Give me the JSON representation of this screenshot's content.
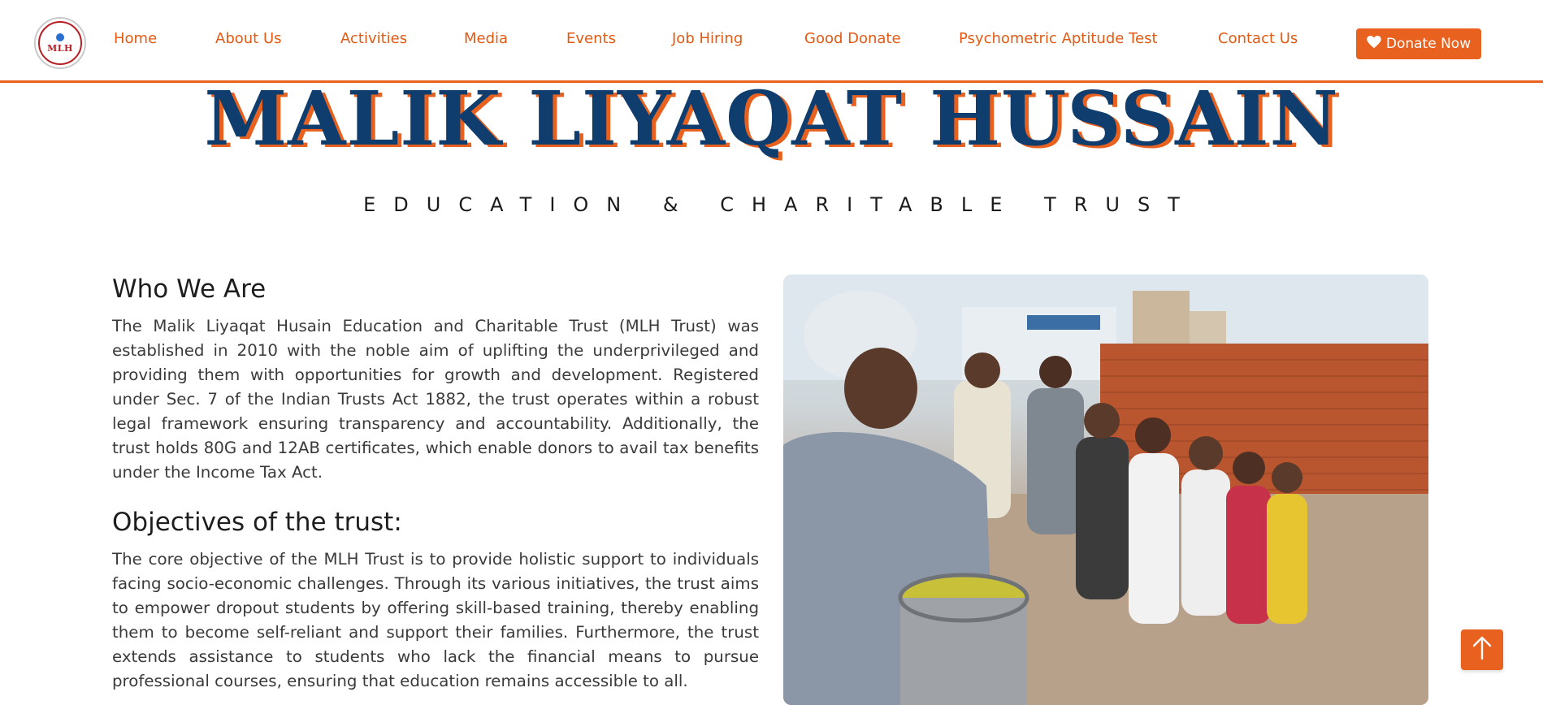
{
  "logo": {
    "text": "MLH"
  },
  "nav": {
    "items": [
      {
        "label": "Home"
      },
      {
        "label": "About Us"
      },
      {
        "label": "Activities"
      },
      {
        "label": "Media"
      },
      {
        "label": "Events"
      },
      {
        "label": "Job Hiring"
      },
      {
        "label": "Good Donate"
      },
      {
        "label": "Psychometric Aptitude Test"
      },
      {
        "label": "Contact Us"
      }
    ],
    "donate_label": "Donate Now"
  },
  "banner": {
    "title": "MALIK LIYAQAT HUSSAIN",
    "subtitle": "EDUCATION & CHARITABLE TRUST"
  },
  "about": {
    "heading": "Who We Are",
    "text": "The Malik Liyaqat Husain Education and Charitable Trust (MLH Trust) was established in 2010 with the noble aim of uplifting the underprivileged and providing them with opportunities for growth and development. Registered under Sec. 7 of the Indian Trusts Act 1882, the trust operates within a robust legal framework ensuring transparency and accountability. Additionally, the trust holds 80G and 12AB certificates, which enable donors to avail tax benefits under the Income Tax Act."
  },
  "objectives": {
    "heading": "Objectives of the trust:",
    "text": "The core objective of the MLH Trust is to provide holistic support to individuals facing socio-economic challenges. Through its various initiatives, the trust aims to empower dropout students by offering skill-based training, thereby enabling them to become self-reliant and support their families. Furthermore, the trust extends assistance to students who lack the financial means to pursue professional courses, ensuring that education remains accessible to all."
  },
  "colors": {
    "accent": "#e8611f",
    "navy": "#0f3d6e"
  },
  "icons": {
    "donate": "heart-icon",
    "scroll_top": "arrow-up-icon"
  }
}
